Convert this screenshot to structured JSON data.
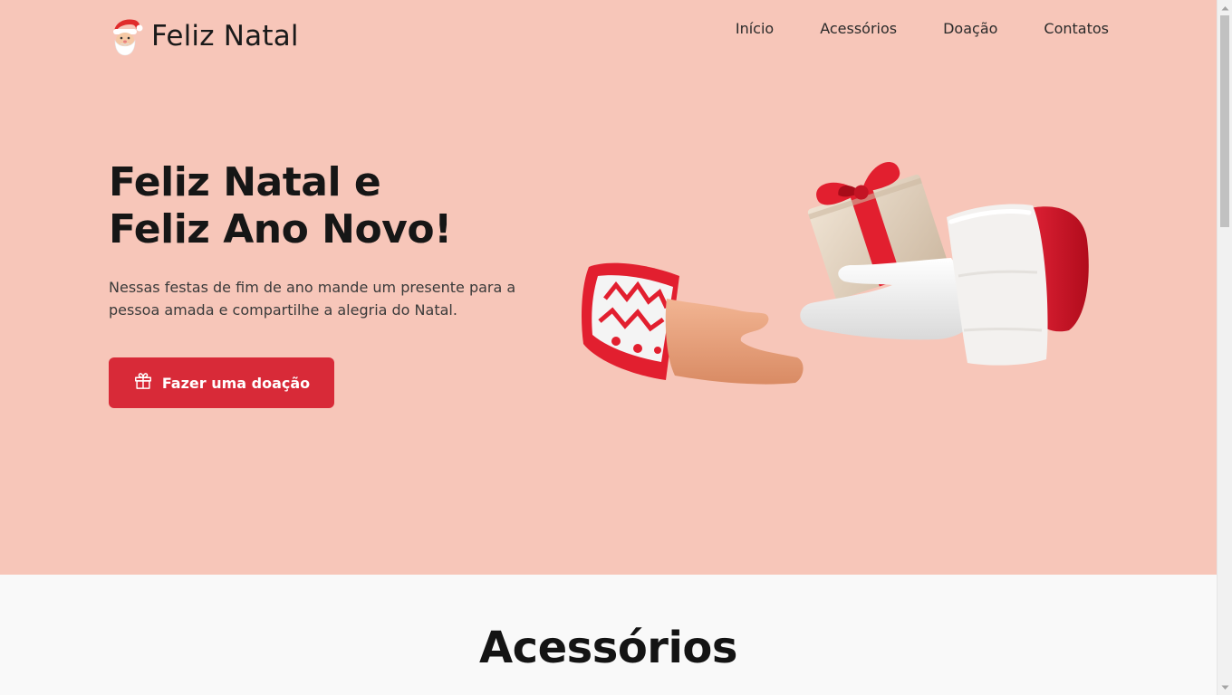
{
  "header": {
    "logo_text": "Feliz Natal",
    "logo_icon": "santa-icon",
    "nav": [
      {
        "label": "Início"
      },
      {
        "label": "Acessórios"
      },
      {
        "label": "Doação"
      },
      {
        "label": "Contatos"
      }
    ]
  },
  "hero": {
    "title_line1": "Feliz Natal e",
    "title_line2": "Feliz Ano Novo!",
    "description": "Nessas festas de fim de ano mande um presente para a pessoa amada e compartilhe a alegria do Natal.",
    "cta_label": "Fazer uma doação",
    "cta_icon": "gift-icon",
    "illustration": "hands-giving-gift-illustration"
  },
  "section": {
    "title": "Acessórios"
  },
  "colors": {
    "hero_bg": "#f7c6b9",
    "accent": "#d82a38",
    "text_dark": "#161616",
    "section_bg": "#f9f9f9"
  }
}
